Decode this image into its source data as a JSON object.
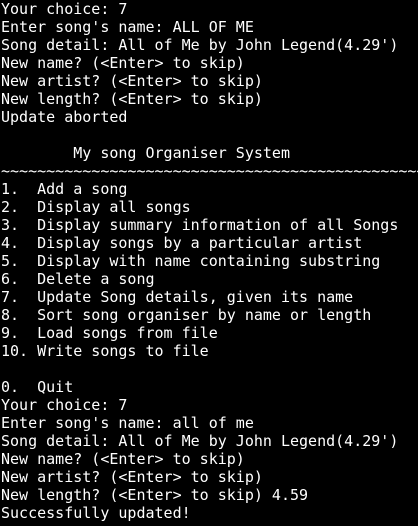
{
  "terminal": {
    "lines": [
      "Your choice: 7",
      "Enter song's name: ALL OF ME",
      "Song detail: All of Me by John Legend(4.29')",
      "New name? (<Enter> to skip)",
      "New artist? (<Enter> to skip)",
      "New length? (<Enter> to skip)",
      "Update aborted",
      "",
      "        My song Organiser System",
      "~~~~~~~~~~~~~~~~~~~~~~~~~~~~~~~~~~~~~~~~~~~~~~~~~~~~",
      "1.  Add a song",
      "2.  Display all songs",
      "3.  Display summary information of all Songs",
      "4.  Display songs by a particular artist",
      "5.  Display with name containing substring",
      "6.  Delete a song",
      "7.  Update Song details, given its name",
      "8.  Sort song organiser by name or length",
      "9.  Load songs from file",
      "10. Write songs to file",
      "",
      "0.  Quit",
      "Your choice: 7",
      "Enter song's name: all of me",
      "Song detail: All of Me by John Legend(4.29')",
      "New name? (<Enter> to skip)",
      "New artist? (<Enter> to skip)",
      "New length? (<Enter> to skip) 4.59",
      "Successfully updated!"
    ]
  },
  "colors": {
    "background": "#000000",
    "foreground": "#ffffff"
  }
}
